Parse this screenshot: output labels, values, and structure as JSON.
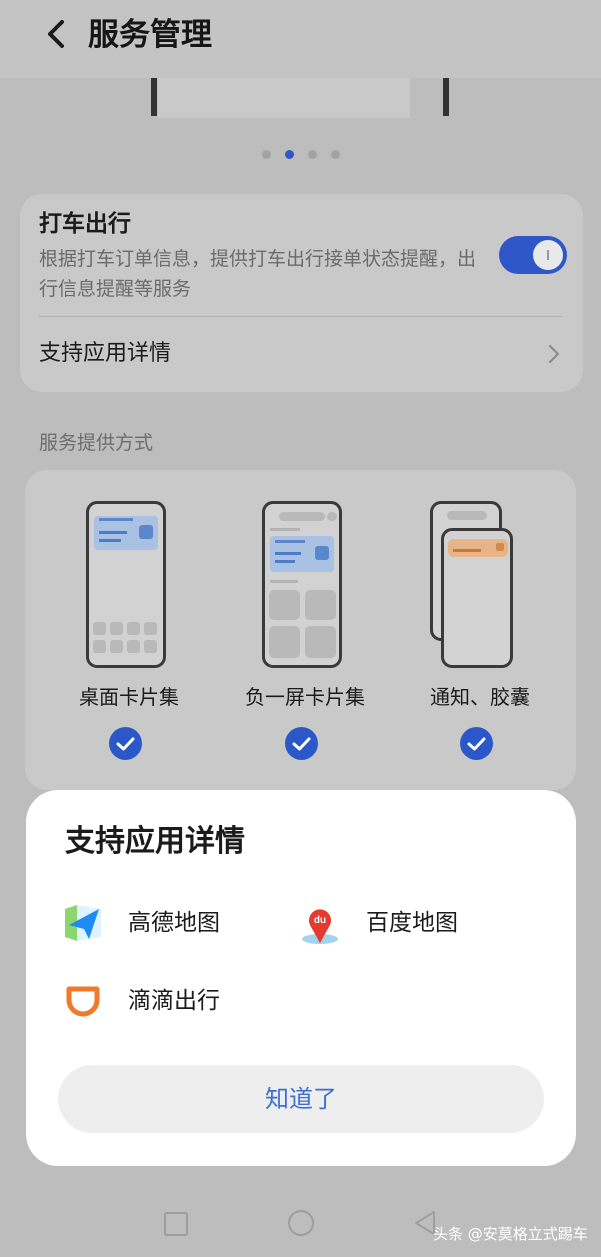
{
  "header": {
    "title": "服务管理"
  },
  "carousel": {
    "page_count": 4,
    "active_index": 1
  },
  "service": {
    "name": "打车出行",
    "description": "根据打车订单信息，提供打车出行接单状态提醒，出行信息提醒等服务",
    "enabled": true,
    "detail_label": "支持应用详情"
  },
  "section": {
    "title": "服务提供方式"
  },
  "modes": [
    {
      "label": "桌面卡片集",
      "checked": true
    },
    {
      "label": "负一屏卡片集",
      "checked": true
    },
    {
      "label": "通知、胶囊",
      "checked": true
    }
  ],
  "sheet": {
    "title": "支持应用详情",
    "apps": [
      {
        "label": "高德地图",
        "icon": "amap-icon"
      },
      {
        "label": "百度地图",
        "icon": "baidu-map-icon"
      },
      {
        "label": "滴滴出行",
        "icon": "didi-icon"
      }
    ],
    "ok_label": "知道了"
  },
  "watermark": "头条 @安莫格立式踢车",
  "colors": {
    "accent": "#2f57c8",
    "link": "#3e6fd0",
    "sheet_bg": "#ffffff",
    "scrim": "#bdbdbd"
  }
}
